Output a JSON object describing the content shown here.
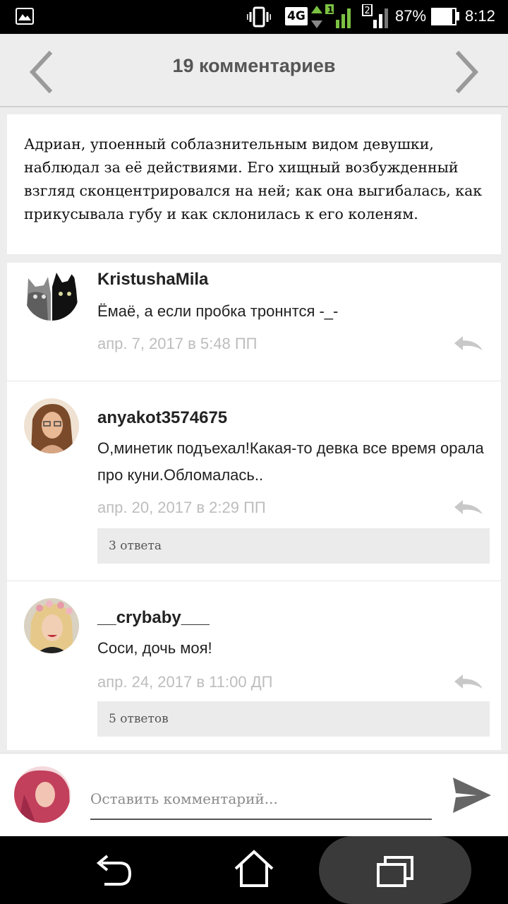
{
  "status_bar": {
    "network": "4G",
    "sim2_label": "2",
    "battery": "87%",
    "battery_level": 0.87,
    "time": "8:12"
  },
  "header": {
    "title": "19 комментариев",
    "prev_icon": "chevron-left-icon",
    "next_icon": "chevron-right-icon"
  },
  "quote": {
    "text": "Адриан, упоенный соблазнительным видом девушки, наблюдал за её действиями. Его хищный возбужденный взгляд сконцентрировался на ней; как она выгибалась, как прикусывала губу и как склонилась к его коленям."
  },
  "comments": [
    {
      "user": "KristushaMila",
      "text": "Ёмаё, а если пробка троннтся -_-",
      "date": "апр. 7, 2017 в 5:48 ПП",
      "replies": ""
    },
    {
      "user": "anyakot3574675",
      "text": "О,минетик подъехал!Какая-то девка все время орала про куни.Обломалась..",
      "date": "апр. 20, 2017 в 2:29 ПП",
      "replies": "3 ответа"
    },
    {
      "user": "__crybaby___",
      "text": "Соси, дочь моя!",
      "date": "апр. 24, 2017 в 11:00 ДП",
      "replies": "5 ответов"
    }
  ],
  "composer": {
    "placeholder": "Оставить комментарий...",
    "send_icon": "send-icon"
  },
  "colors": {
    "header_bg": "#ededed",
    "date_text": "#bdbdbd",
    "replies_bg": "#ebebeb"
  }
}
